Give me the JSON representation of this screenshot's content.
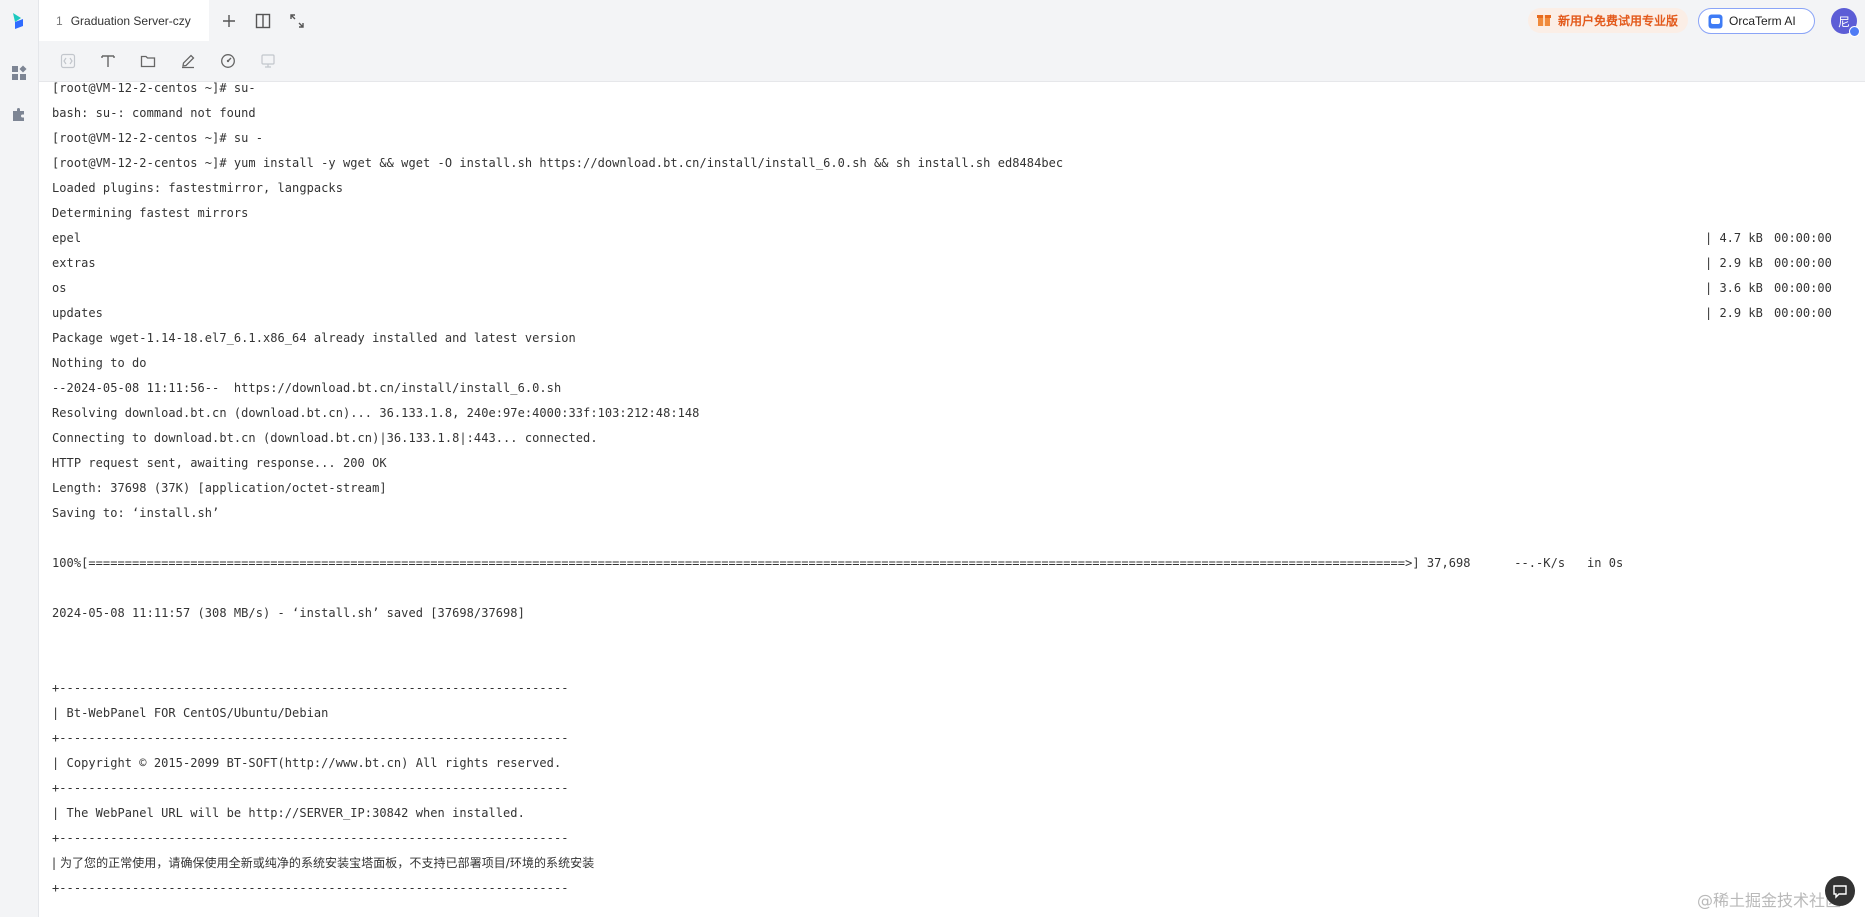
{
  "rail": {
    "items": [
      {
        "name": "apps-grid-icon"
      },
      {
        "name": "puzzle-plugin-icon"
      }
    ]
  },
  "tabbar": {
    "tab": {
      "index": "1",
      "title": "Graduation Server-czy"
    },
    "promo_label": "新用户免费试用专业版",
    "ai_label": "OrcaTerm AI",
    "avatar_text": "尼"
  },
  "toolbar": {
    "tools": [
      "code-icon",
      "text-format-icon",
      "folder-icon",
      "edit-pen-icon",
      "dashboard-gauge-icon",
      "monitor-icon"
    ]
  },
  "terminal": {
    "lines": [
      "[root@VM-12-2-centos ~]# su-",
      "bash: su-: command not found",
      "[root@VM-12-2-centos ~]# su -",
      "[root@VM-12-2-centos ~]# yum install -y wget && wget -O install.sh https://download.bt.cn/install/install_6.0.sh && sh install.sh ed8484bec",
      "Loaded plugins: fastestmirror, langpacks",
      "Determining fastest mirrors",
      "epel",
      "extras",
      "os",
      "updates",
      "Package wget-1.14-18.el7_6.1.x86_64 already installed and latest version",
      "Nothing to do",
      "--2024-05-08 11:11:56--  https://download.bt.cn/install/install_6.0.sh",
      "Resolving download.bt.cn (download.bt.cn)... 36.133.1.8, 240e:97e:4000:33f:103:212:48:148",
      "Connecting to download.bt.cn (download.bt.cn)|36.133.1.8|:443... connected.",
      "HTTP request sent, awaiting response... 200 OK",
      "Length: 37698 (37K) [application/octet-stream]",
      "Saving to: ‘install.sh’",
      "",
      "100%[=====================================================================================================================================================================================>] 37,698      --.-K/s   in 0s",
      "",
      "2024-05-08 11:11:57 (308 MB/s) - ‘install.sh’ saved [37698/37698]",
      "",
      "",
      "+----------------------------------------------------------------------",
      "| Bt-WebPanel FOR CentOS/Ubuntu/Debian",
      "+----------------------------------------------------------------------",
      "| Copyright © 2015-2099 BT-SOFT(http://www.bt.cn) All rights reserved.",
      "+----------------------------------------------------------------------",
      "| The WebPanel URL will be http://SERVER_IP:30842 when installed.",
      "+----------------------------------------------------------------------",
      "| 为了您的正常使用，请确保使用全新或纯净的系统安装宝塔面板，不支持已部署项目/环境的系统安装",
      "+----------------------------------------------------------------------"
    ],
    "mirror_stats": [
      {
        "size": "| 4.7 kB",
        "time": "00:00:00"
      },
      {
        "size": "| 2.9 kB",
        "time": "00:00:00"
      },
      {
        "size": "| 3.6 kB",
        "time": "00:00:00"
      },
      {
        "size": "| 2.9 kB",
        "time": "00:00:00"
      }
    ]
  },
  "watermark": "@稀土掘金技术社区"
}
